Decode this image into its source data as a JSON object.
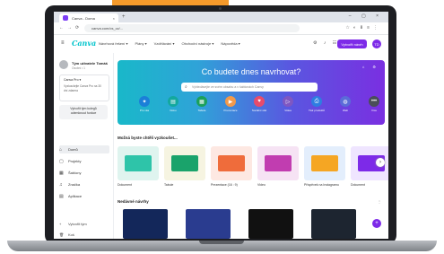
{
  "browser": {
    "tab_title": "Canva - Doma",
    "url": "canva.com/cs_cz/...",
    "tab_close": "×",
    "new_tab": "+",
    "window_controls": "– ▢ ×"
  },
  "header": {
    "logo": "Canva",
    "menu": [
      "Návrhová řešení ▾",
      "Plány ▾",
      "Vzdělávání ▾",
      "Obchodní nástroje ▾",
      "Nápověda ▾"
    ],
    "create_button": "Vytvořit návrh",
    "avatar_initials": "TD"
  },
  "sidebar": {
    "profile_name": "Tým uživatele Tomáš",
    "profile_sub": "Osobní • 1",
    "trial_title": "Canva Pro ▾",
    "trial_text": "Vyzkoušejte Canva Pro na 30 dní zdarma",
    "upgrade": "Vytvořit tým kolegů\nodemknout funkce",
    "items": [
      {
        "icon": "⌂",
        "label": "Domů"
      },
      {
        "icon": "▢",
        "label": "Projekty"
      },
      {
        "icon": "▦",
        "label": "Šablony"
      },
      {
        "icon": "♫",
        "label": "Značka"
      },
      {
        "icon": "▤",
        "label": "Aplikace"
      }
    ],
    "bottom": [
      {
        "icon": "+",
        "label": "Vytvořit tým"
      },
      {
        "icon": "🗑",
        "label": "Koš"
      }
    ]
  },
  "banner": {
    "title": "Co budete dnes navrhovat?",
    "search_placeholder": "Vyhledávejte ve svém obsahu a v šablonách Canvy",
    "categories": [
      {
        "label": "Pro vás",
        "color": "#1b7fd8",
        "icon": "✦"
      },
      {
        "label": "Doku",
        "color": "#13a89e",
        "icon": "▤"
      },
      {
        "label": "Tabule",
        "color": "#1ba05b",
        "icon": "▦"
      },
      {
        "label": "Prezentace",
        "color": "#f2994a",
        "icon": "▶"
      },
      {
        "label": "Sociální sítě",
        "color": "#e84b6b",
        "icon": "♥"
      },
      {
        "label": "Videa",
        "color": "#7e57c2",
        "icon": "▷"
      },
      {
        "label": "Tisk produktů",
        "color": "#2e7de1",
        "icon": "⎙"
      },
      {
        "label": "Web",
        "color": "#5b6bd8",
        "icon": "◍"
      },
      {
        "label": "Více",
        "color": "#4a4e59",
        "icon": "•••"
      }
    ]
  },
  "templates": {
    "title": "Možná byste chtěli vyzkoušet...",
    "items": [
      {
        "label": "Dokument",
        "color": "#dff4ef",
        "accent": "#2ec4a9"
      },
      {
        "label": "Tabule",
        "color": "#f6f4e1",
        "accent": "#1aa36b"
      },
      {
        "label": "Prezentace (16 : 9)",
        "color": "#fde8e2",
        "accent": "#ef6c3b"
      },
      {
        "label": "Video",
        "color": "#f6e3f4",
        "accent": "#c13db0"
      },
      {
        "label": "Příspěvek na Instagramu",
        "color": "#e3eefc",
        "accent": "#f5a623"
      },
      {
        "label": "Dokument",
        "color": "#efe5ff",
        "accent": "#7d2ae8"
      }
    ]
  },
  "recent": {
    "title": "Nedávné návrhy",
    "more": "⋮",
    "items": [
      {
        "color": "#13275a"
      },
      {
        "color": "#2a3c8f"
      },
      {
        "color": "#111111"
      },
      {
        "color": "#1d2530"
      }
    ]
  },
  "fab": "+"
}
